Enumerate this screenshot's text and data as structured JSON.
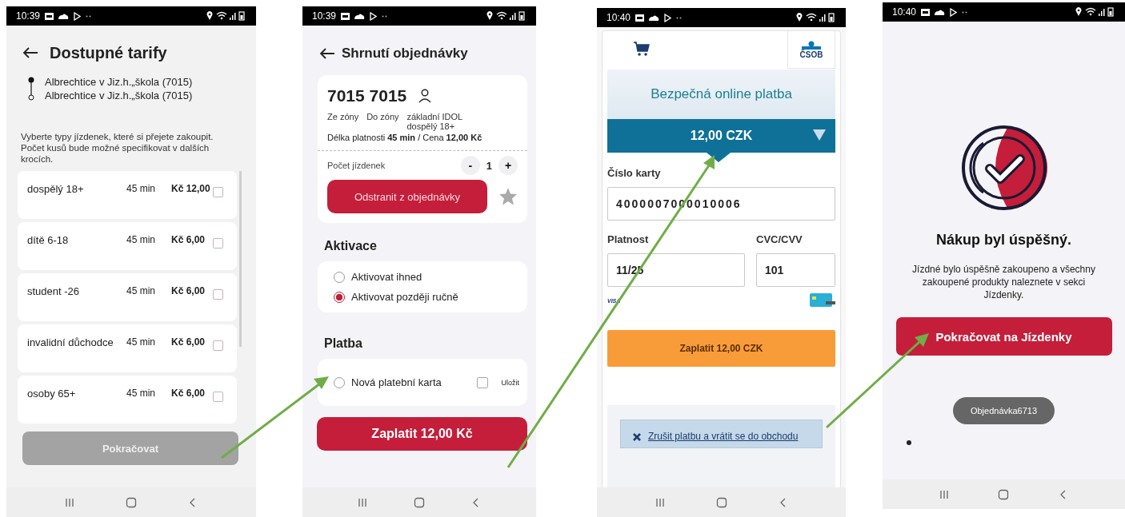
{
  "tariffs_screen": {
    "status_time": "10:39",
    "title": "Dostupné tarify",
    "route": [
      "Albrechtice v Jiz.h.„škola (7015)",
      "Albrechtice v Jiz.h.„škola (7015)"
    ],
    "hint": "Vyberte typy jízdenek, které si přejete zakoupit. Počet kusů bude možné specifikovat v dalších krocích.",
    "tariffs": [
      {
        "name": "dospělý 18+",
        "duration": "45 min",
        "price": "Kč 12,00",
        "checked": false
      },
      {
        "name": "dítě 6-18",
        "duration": "45 min",
        "price": "Kč 6,00",
        "checked": false
      },
      {
        "name": "student -26",
        "duration": "45 min",
        "price": "Kč 6,00",
        "checked": false
      },
      {
        "name": "invalidní důchodce",
        "duration": "45 min",
        "price": "Kč 6,00",
        "checked": false
      },
      {
        "name": "osoby 65+",
        "duration": "45 min",
        "price": "Kč 6,00",
        "checked": false
      }
    ],
    "continue_button": {
      "label": "Pokračovat",
      "disabled": true
    }
  },
  "summary_screen": {
    "status_time": "10:39",
    "title": "Shrnutí objednávky",
    "zones": "7015 7015",
    "from_label": "Ze zóny",
    "to_label": "Do zóny",
    "tariff_name": "základní IDOL dospělý 18+",
    "validity": "Délka platnosti **45 min** / Cena  **12,00 Kč**",
    "count_label": "Počet jízdenek",
    "decrement": "-",
    "count": "1",
    "increment": "+",
    "remove_button": "Odstranit z objednávky",
    "favorite": false,
    "activation_heading": "Aktivace",
    "activation_options": [
      {
        "label": "Aktivovat ihned",
        "selected": false
      },
      {
        "label": "Aktivovat později ručně",
        "selected": true
      }
    ],
    "payment_heading": "Platba",
    "payment_options": [
      {
        "label": "Nová platební karta",
        "selected": false
      }
    ],
    "save_card": {
      "label": "Uložit",
      "checked": false
    },
    "pay_button": "Zaplatit 12,00 Kč"
  },
  "payment_screen": {
    "status_time": "10:40",
    "bank_logo": "ČSOB",
    "heading": "Bezpečná online platba",
    "amount": "12,00 CZK",
    "card_number_label": "Číslo karty",
    "card_number": "4000007000010006",
    "expiry_label": "Platnost",
    "expiry": "11/25",
    "cvc_label": "CVC/CVV",
    "cvc": "101",
    "card_brand": "VISA",
    "pay_button": "Zaplatit 12,00 CZK",
    "cancel_link": "Zrušit platbu a vrátit se do obchodu"
  },
  "success_screen": {
    "status_time": "10:40",
    "title": "Nákup byl úspěšný.",
    "message": "Jízdné bylo úspěšně zakoupeno a všechny zakoupené produkty naleznete v sekci Jízdenky.",
    "continue_button": "Pokračovat na Jízdenky",
    "toast": "Objednávka6713"
  }
}
